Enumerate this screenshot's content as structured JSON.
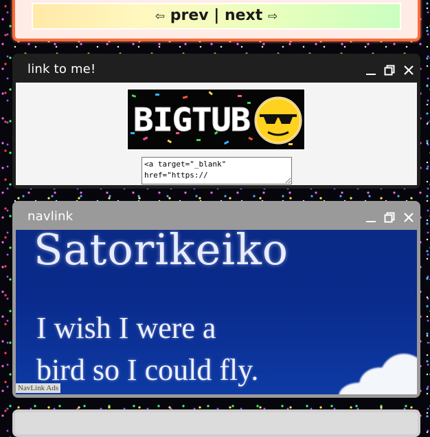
{
  "pager": {
    "prev_arrow": "⇦",
    "prev": "prev",
    "sep": "|",
    "next": "next",
    "next_arrow": "⇨"
  },
  "link_window": {
    "title": "link to me!",
    "banner_alt": "BIGTUB",
    "embed_code": "<a target=\"_blank\" href=\"https://"
  },
  "nav_window": {
    "title": "navlink",
    "ad_heading": "Satorikeiko",
    "ad_line1": "I wish I were a",
    "ad_line2": "bird so I could fly.",
    "ad_tag": "NavLink Ads"
  },
  "colors": {
    "accent_orange": "#ff6b3d",
    "titlebar_dark": "#1f1f1f",
    "titlebar_gray": "#9a9a9a"
  }
}
